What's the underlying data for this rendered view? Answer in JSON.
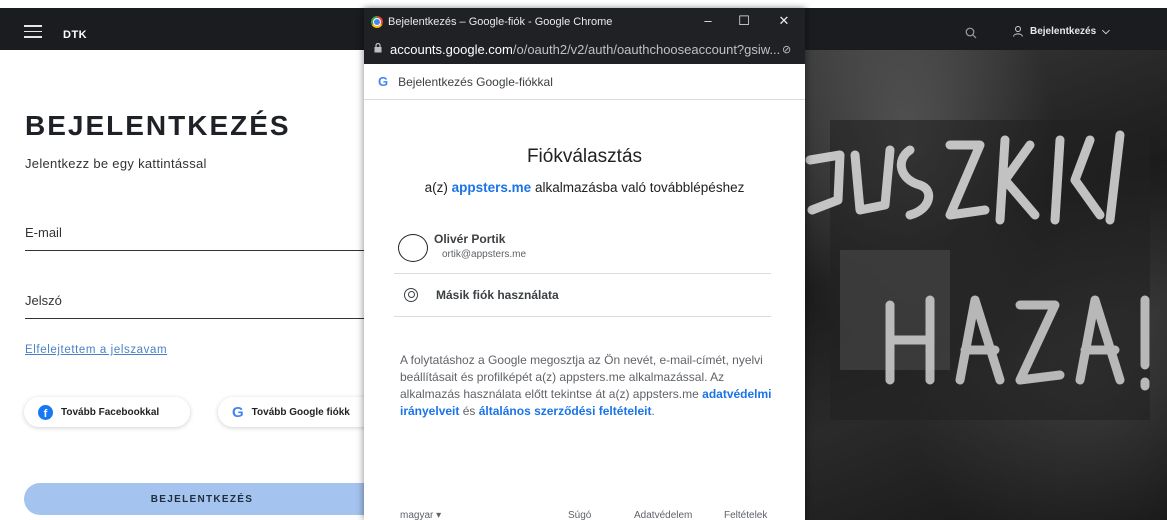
{
  "site": {
    "brand": "DTK",
    "nav_login": "Bejelentkezés",
    "nav_login_caret": "⌵"
  },
  "login": {
    "title": "BEJELENTKEZÉS",
    "subtitle": "Jelentkezz be egy kattintással",
    "email_label": "E-mail",
    "password_label": "Jelszó",
    "forgot": "Elfelejtettem a jelszavam",
    "facebook_button": "Tovább Facebookkal",
    "google_button": "Tovább Google fiókk",
    "submit": "BEJELENTKEZÉS"
  },
  "popup": {
    "window_title": "Bejelentkezés – Google-fiók - Google Chrome",
    "url_host": "accounts.google.com",
    "url_path": "/o/oauth2/v2/auth/oauthchooseaccount?gsiw...",
    "header": "Bejelentkezés Google-fiókkal",
    "title": "Fiókválasztás",
    "subtitle_prefix": "a(z) ",
    "subtitle_app": "appsters.me",
    "subtitle_suffix": " alkalmazásba való továbblépéshez",
    "account": {
      "name": "Olivér Portik",
      "email": "ortik@appsters.me"
    },
    "other_account": "Másik fiók használata",
    "notice_text": "A folytatáshoz a Google megosztja az Ön nevét, e-mail-címét, nyelvi beállításait és profilképét a(z) appsters.me alkalmazással. Az alkalmazás használata előtt tekintse át a(z) appsters.me ",
    "notice_privacy": "adatvédelmi irányelveit",
    "notice_and": " és ",
    "notice_terms": "általános szerződési feltételeit",
    "notice_end": ".",
    "footer": {
      "language": "magyar ▾",
      "help": "Súgó",
      "privacy": "Adatvédelem",
      "terms": "Feltételek"
    }
  },
  "icons": {
    "hamburger": "hamburger-menu-icon",
    "search": "search-icon",
    "user": "user-icon",
    "facebook": "facebook-icon",
    "google": "google-icon",
    "lock": "lock-icon",
    "account_circle": "account-circle-icon"
  },
  "colors": {
    "nav_bg": "#1a1c1f",
    "accent_link": "#4a80c8",
    "submit_bg": "#a4c3ee",
    "google_blue": "#1a73e8",
    "chrome_titlebar": "#202124"
  }
}
